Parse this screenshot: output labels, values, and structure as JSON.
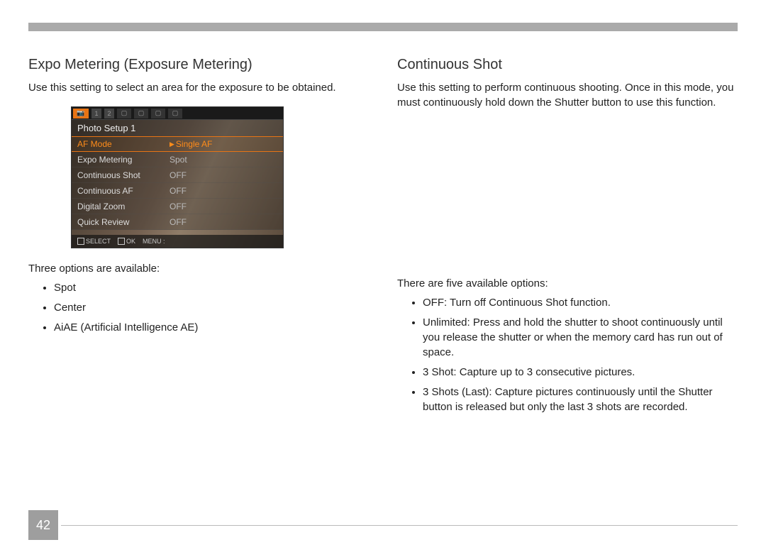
{
  "page_number": "42",
  "left": {
    "heading": "Expo Metering (Exposure Metering)",
    "intro": "Use this setting to select an area for the exposure to be obtained.",
    "options_intro": "Three options are available:",
    "options": [
      "Spot",
      "Center",
      "AiAE (Artificial Intelligence AE)"
    ]
  },
  "right": {
    "heading": "Continuous Shot",
    "intro": "Use this setting to perform continuous shooting. Once in this mode, you must continuously hold down the Shutter button to use this function.",
    "options_intro": "There are five available options:",
    "options": [
      "OFF: Turn off Continuous Shot function.",
      "Unlimited: Press and hold the shutter to shoot continuously until you release the shutter or when the memory card has run out of space.",
      "3 Shot: Capture up to 3 consecutive pictures.",
      "3 Shots (Last): Capture pictures continuously until the Shutter button is released but only the last 3 shots are recorded."
    ]
  },
  "screenshot": {
    "tab_cam": "📷",
    "tab_1": "1",
    "tab_2": "2",
    "title": "Photo Setup 1",
    "rows": [
      {
        "label": "AF Mode",
        "value": "Single AF",
        "selected": true
      },
      {
        "label": "Expo Metering",
        "value": "Spot",
        "selected": false
      },
      {
        "label": "Continuous Shot",
        "value": "OFF",
        "selected": false
      },
      {
        "label": "Continuous AF",
        "value": "OFF",
        "selected": false
      },
      {
        "label": "Digital Zoom",
        "value": "OFF",
        "selected": false
      },
      {
        "label": "Quick Review",
        "value": "OFF",
        "selected": false
      }
    ],
    "footer_select": "SELECT",
    "footer_ok": "OK",
    "footer_menu": "MENU :"
  }
}
